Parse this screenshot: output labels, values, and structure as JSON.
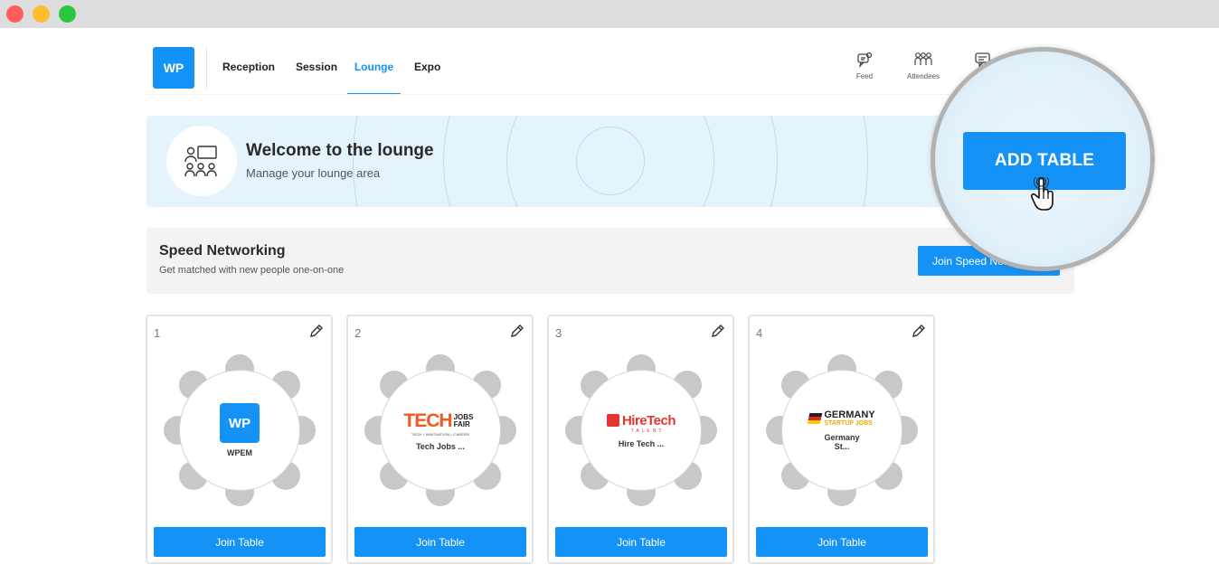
{
  "nav": {
    "logo": "WP",
    "tabs": [
      {
        "label": "Reception",
        "active": false
      },
      {
        "label": "Session",
        "active": false
      },
      {
        "label": "Lounge",
        "active": true
      },
      {
        "label": "Expo",
        "active": false
      }
    ],
    "tools": [
      {
        "label": "Feed",
        "icon": "feed-icon"
      },
      {
        "label": "Attendees",
        "icon": "attendees-icon"
      },
      {
        "label": "",
        "icon": "chat-icon"
      }
    ]
  },
  "banner": {
    "title": "Welcome to the lounge",
    "subtitle": "Manage your lounge area",
    "icon": "lounge-people-icon"
  },
  "speed_networking": {
    "title": "Speed Networking",
    "subtitle": "Get matched with new people one-on-one",
    "button": "Join Speed Networking"
  },
  "tables": [
    {
      "number": "1",
      "name": "WPEM",
      "logo": "WP",
      "join": "Join Table"
    },
    {
      "number": "2",
      "name": "Tech Jobs ...",
      "logo_main": "TECH",
      "logo_side": "JOBS FAIR",
      "logo_tag": "TECH • INNOVATION • CAREER",
      "join": "Join Table"
    },
    {
      "number": "3",
      "name": "Hire Tech ...",
      "logo_main": "HireTech",
      "logo_tag": "TALENT",
      "join": "Join Table"
    },
    {
      "number": "4",
      "name": "Germany St...",
      "logo_main": "GERMANY",
      "logo_tag": "STARTUP JOBS",
      "join": "Join Table"
    }
  ],
  "zoom": {
    "button": "ADD TABLE"
  },
  "colors": {
    "accent": "#1492f5",
    "banner_bg": "#e5f3fd",
    "speed_bg": "#f3f3f3",
    "seat": "#c8c8c8"
  }
}
